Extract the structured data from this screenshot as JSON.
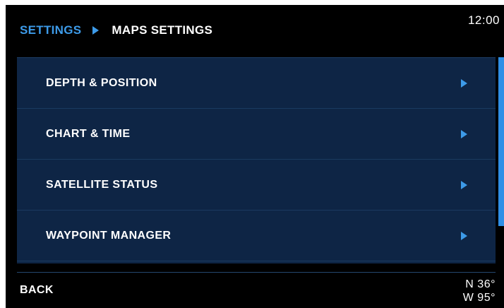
{
  "header": {
    "breadcrumb_root": "SETTINGS",
    "breadcrumb_current": "MAPS SETTINGS",
    "clock": "12:00"
  },
  "menu": {
    "items": [
      {
        "label": "DEPTH & POSITION"
      },
      {
        "label": "CHART & TIME"
      },
      {
        "label": "SATELLITE STATUS"
      },
      {
        "label": "WAYPOINT MANAGER"
      }
    ]
  },
  "footer": {
    "back_label": "BACK",
    "latitude": "N 36°",
    "longitude": "W 95°"
  },
  "colors": {
    "accent": "#3d9be9",
    "panel": "#0e2545",
    "background": "#000000",
    "text": "#ffffff"
  },
  "icons": {
    "breadcrumb_separator": "triangle-right-icon",
    "row_arrow": "chevron-right-icon"
  },
  "scroll": {
    "visible_fraction": 0.82
  }
}
